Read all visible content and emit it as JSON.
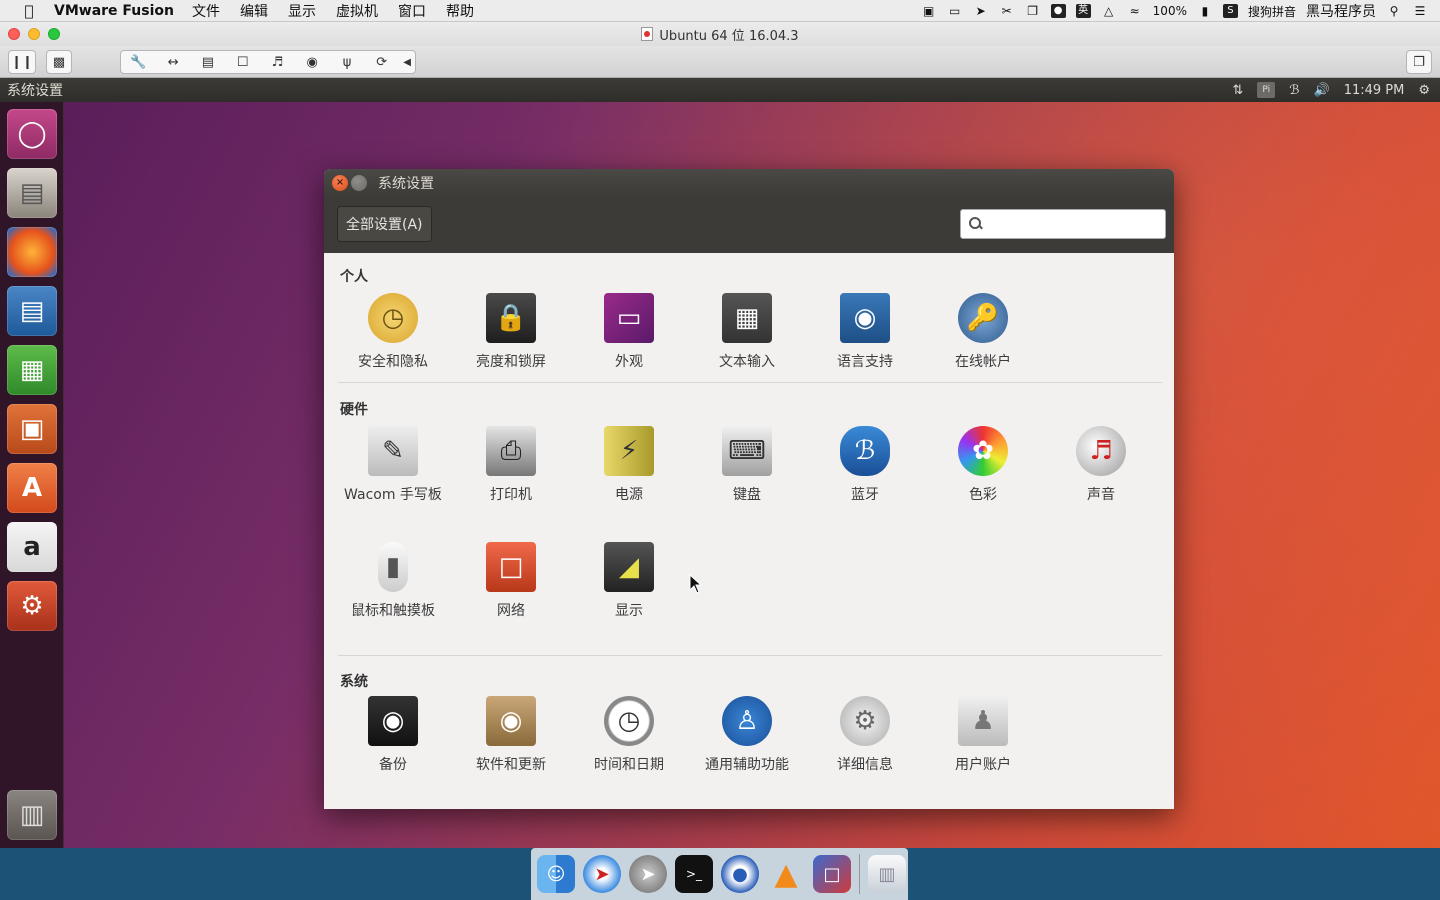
{
  "mac_menubar": {
    "app_name": "VMware Fusion",
    "menus": [
      "文件",
      "编辑",
      "显示",
      "虚拟机",
      "窗口",
      "帮助"
    ],
    "battery": "100%",
    "input_method": "搜狗拼音",
    "user": "黑马程序员"
  },
  "vm_window": {
    "title": "Ubuntu 64 位 16.04.3"
  },
  "ubuntu_panel": {
    "title": "系统设置",
    "time": "11:49 PM",
    "kb_indicator": "Pi"
  },
  "settings": {
    "window_title": "系统设置",
    "all_settings_label": "全部设置(A)",
    "search": {
      "value": "",
      "placeholder": ""
    },
    "sections": [
      {
        "title": "个人",
        "items": [
          "安全和隐私",
          "亮度和锁屏",
          "外观",
          "文本输入",
          "语言支持",
          "在线帐户"
        ]
      },
      {
        "title": "硬件",
        "items": [
          "Wacom 手写板",
          "打印机",
          "电源",
          "键盘",
          "蓝牙",
          "色彩",
          "声音",
          "鼠标和触摸板",
          "网络",
          "显示"
        ]
      },
      {
        "title": "系统",
        "items": [
          "备份",
          "软件和更新",
          "时间和日期",
          "通用辅助功能",
          "详细信息",
          "用户账户"
        ]
      }
    ]
  },
  "launcher": {
    "items": [
      "ubuntu-dash",
      "files",
      "firefox",
      "libreoffice-writer",
      "libreoffice-calc",
      "libreoffice-impress",
      "software-center",
      "amazon",
      "system-settings",
      "trash"
    ]
  },
  "dock": {
    "items": [
      "finder",
      "safari",
      "launchpad",
      "terminal",
      "photo-app",
      "vlc",
      "vmware-fusion",
      "trash"
    ]
  },
  "colors": {
    "ubuntu_panel": "#3c3b37",
    "close_button": "#df4a16",
    "desktop_start": "#5a1e5a",
    "desktop_end": "#e0552a"
  }
}
